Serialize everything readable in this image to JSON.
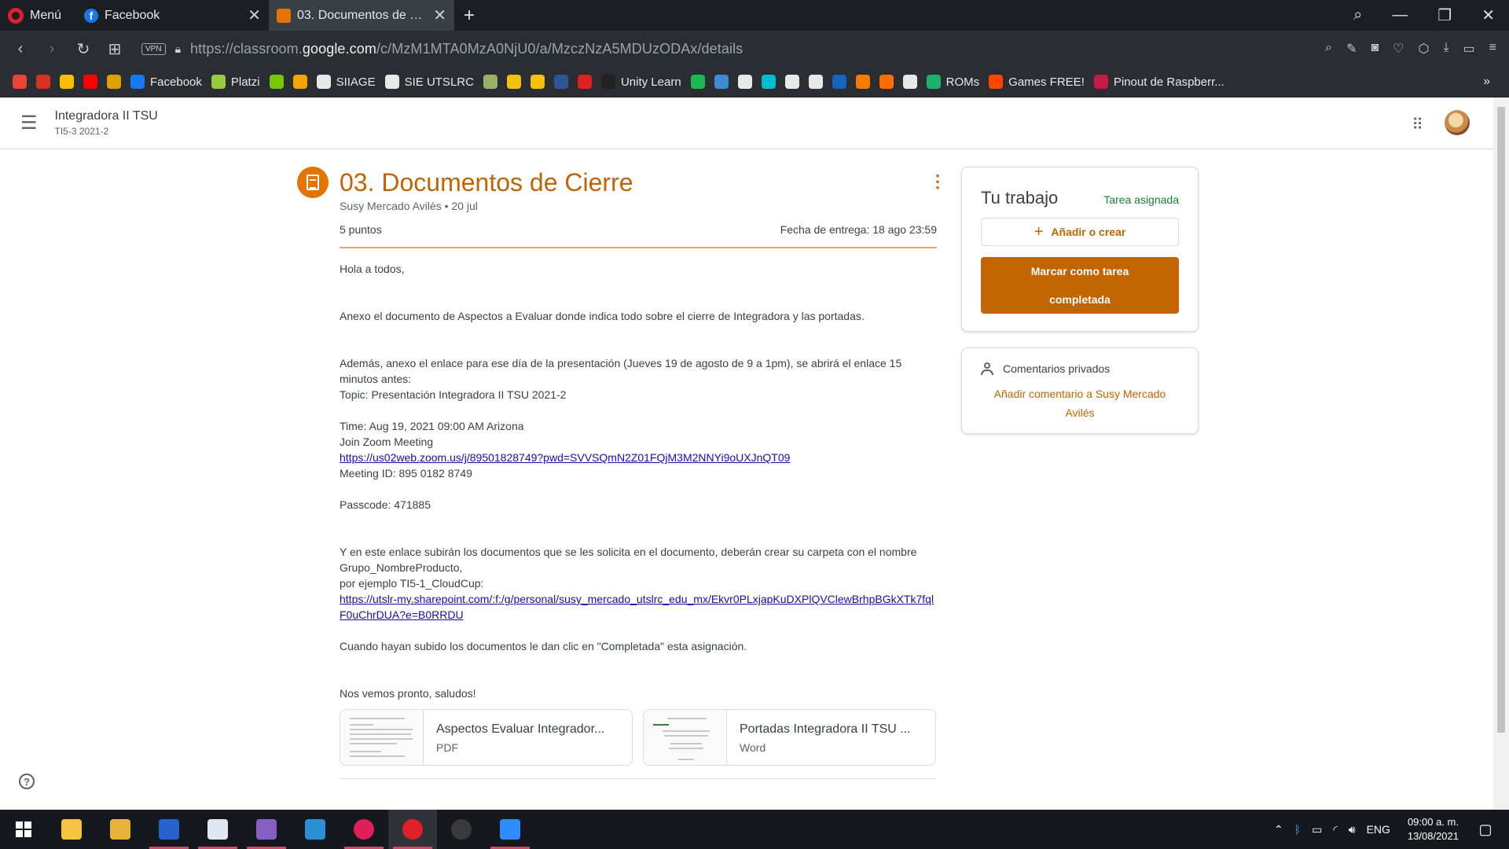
{
  "browser": {
    "menu_label": "Menú",
    "tabs": [
      {
        "title": "Facebook",
        "icon": "facebook-icon"
      },
      {
        "title": "03. Documentos de Cierre",
        "icon": "classroom-icon"
      }
    ],
    "url_prefix": "https://classroom.",
    "url_domain": "google.com",
    "url_path": "/c/MzM1MTA0MzA0NjU0/a/MzczNzA5MDUzODAx/details",
    "vpn_label": "VPN"
  },
  "bookmarks": [
    {
      "label": "",
      "color": "#ea4335"
    },
    {
      "label": "",
      "color": "#d93025"
    },
    {
      "label": "",
      "color": "#fbbc04"
    },
    {
      "label": "",
      "color": "#ff0000"
    },
    {
      "label": "",
      "color": "#e0a000"
    },
    {
      "label": "Facebook",
      "color": "#1877f2"
    },
    {
      "label": "Platzi",
      "color": "#98ca3f"
    },
    {
      "label": "",
      "color": "#78c800"
    },
    {
      "label": "",
      "color": "#f0a500"
    },
    {
      "label": "SIIAGE",
      "color": "#e8e8e8"
    },
    {
      "label": "SIE UTSLRC",
      "color": "#e8e8e8"
    },
    {
      "label": "",
      "color": "#9bb069"
    },
    {
      "label": "",
      "color": "#f4c20d"
    },
    {
      "label": "",
      "color": "#f4c20d"
    },
    {
      "label": "",
      "color": "#2b579a"
    },
    {
      "label": "",
      "color": "#e02020"
    },
    {
      "label": "Unity Learn",
      "color": "#222"
    },
    {
      "label": "",
      "color": "#1db954"
    },
    {
      "label": "",
      "color": "#3d8bd5"
    },
    {
      "label": "",
      "color": "#e8e8e8"
    },
    {
      "label": "",
      "color": "#00bcd4"
    },
    {
      "label": "",
      "color": "#e8e8e8"
    },
    {
      "label": "",
      "color": "#e8e8e8"
    },
    {
      "label": "",
      "color": "#1565c0"
    },
    {
      "label": "",
      "color": "#f57c00"
    },
    {
      "label": "",
      "color": "#ff6d00"
    },
    {
      "label": "",
      "color": "#e8e8e8"
    },
    {
      "label": "ROMs",
      "color": "#1bb36b"
    },
    {
      "label": "Games FREE!",
      "color": "#ff4500"
    },
    {
      "label": "Pinout de Raspberr...",
      "color": "#c51a4a"
    }
  ],
  "classroom": {
    "course_name": "Integradora II TSU",
    "course_section": "TI5-3 2021-2",
    "assignment": {
      "title": "03. Documentos de Cierre",
      "meta": "Susy Mercado Avilés • 20 jul",
      "points": "5 puntos",
      "due": "Fecha de entrega: 18 ago 23:59",
      "body": [
        {
          "text": "Hola a todos,"
        },
        {
          "text": ""
        },
        {
          "text": ""
        },
        {
          "text": "Anexo el documento de Aspectos a Evaluar donde indica todo sobre el cierre de Integradora y las portadas."
        },
        {
          "text": ""
        },
        {
          "text": ""
        },
        {
          "text": "Además, anexo el enlace para ese día de la presentación (Jueves 19 de agosto de 9 a 1pm), se abrirá el enlace 15 minutos antes:"
        },
        {
          "text": "Topic: Presentación Integradora II TSU 2021-2"
        },
        {
          "text": ""
        },
        {
          "text": "Time: Aug 19, 2021 09:00 AM Arizona"
        },
        {
          "text": "Join Zoom Meeting"
        },
        {
          "link": "https://us02web.zoom.us/j/89501828749?pwd=SVVSQmN2Z01FQjM3M2NNYi9oUXJnQT09"
        },
        {
          "text": "Meeting ID: 895 0182 8749"
        },
        {
          "text": ""
        },
        {
          "text": "Passcode: 471885"
        },
        {
          "text": ""
        },
        {
          "text": ""
        },
        {
          "text": "Y en este enlace subirán los documentos que se les solicita en el documento, deberán crear su carpeta con el nombre Grupo_NombreProducto,"
        },
        {
          "text": "por ejemplo TI5-1_CloudCup:"
        },
        {
          "link": "https://utslr-my.sharepoint.com/:f:/g/personal/susy_mercado_utslrc_edu_mx/Ekvr0PLxjapKuDXPlQVClewBrhpBGkXTk7fqlF0uChrDUA?e=B0RRDU"
        },
        {
          "text": ""
        },
        {
          "text": "Cuando hayan subido los documentos le dan clic en \"Completada\" esta asignación."
        },
        {
          "text": ""
        },
        {
          "text": ""
        },
        {
          "text": "Nos vemos pronto, saludos!"
        }
      ],
      "attachments": [
        {
          "name": "Aspectos Evaluar Integrador...",
          "type": "PDF"
        },
        {
          "name": "Portadas Integradora II TSU ...",
          "type": "Word"
        }
      ]
    },
    "work": {
      "title": "Tu trabajo",
      "status": "Tarea asignada",
      "add_label": "Añadir o crear",
      "done_label": "Marcar como tarea completada"
    },
    "comments": {
      "title": "Comentarios privados",
      "add_label": "Añadir comentario a Susy Mercado Avilés"
    }
  },
  "taskbar": {
    "apps": [
      {
        "name": "file-explorer",
        "color": "#f5c542"
      },
      {
        "name": "folder",
        "color": "#e8b33a"
      },
      {
        "name": "todo",
        "color": "#2564cf"
      },
      {
        "name": "notepad",
        "color": "#dfe7f2"
      },
      {
        "name": "visual-studio",
        "color": "#865fc5"
      },
      {
        "name": "vscode",
        "color": "#2b8fd6"
      },
      {
        "name": "slack",
        "color": "#e01e5a"
      },
      {
        "name": "opera",
        "color": "#e11f2a"
      },
      {
        "name": "obs",
        "color": "#3a3a3a"
      },
      {
        "name": "zoom",
        "color": "#2d8cff"
      }
    ],
    "language": "ENG",
    "time": "09:00 a. m.",
    "date": "13/08/2021"
  }
}
